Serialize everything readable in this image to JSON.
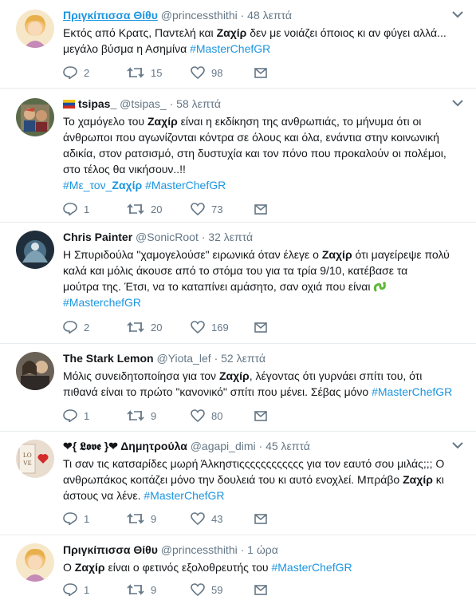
{
  "tweets": [
    {
      "name": "Πριγκίπισσα Θίθυ",
      "handle": "@princessthithi",
      "time": "48 λεπτά",
      "lines": [
        [
          {
            "t": "Εκτός από Κρατς, Παντελή και "
          },
          {
            "t": "Ζαχίρ",
            "b": true
          },
          {
            "t": " δεν με νοιάζει όποιος κι αν φύγει αλλά..."
          }
        ],
        [
          {
            "t": "μεγάλο βύσμα η Ασημίνα "
          },
          {
            "t": "#MasterChefGR",
            "h": true
          }
        ]
      ],
      "replies": "2",
      "retweets": "15",
      "likes": "98"
    },
    {
      "name": "tsipas_",
      "handle": "@tsipas_",
      "time": "58 λεπτά",
      "lines": [
        [
          {
            "t": "Το χαμόγελο του "
          },
          {
            "t": "Ζαχίρ",
            "b": true
          },
          {
            "t": " είναι η εκδίκηση της ανθρωπιάς, το μήνυμα ότι οι"
          }
        ],
        [
          {
            "t": "άνθρωποι που αγωνίζονται κόντρα σε όλους και όλα, ενάντια στην κοινωνική"
          }
        ],
        [
          {
            "t": "αδικία, στον ρατσισμό, στη δυστυχία και τον πόνο που προκαλούν οι πολέμοι,"
          }
        ],
        [
          {
            "t": "στο τέλος θα νικήσουν..!!"
          }
        ],
        [
          {
            "t": "#Με_τον_",
            "h": true
          },
          {
            "t": "Ζαχίρ",
            "h": true,
            "b": true
          },
          {
            "t": " "
          },
          {
            "t": "#MasterChefGR",
            "h": true
          }
        ]
      ],
      "replies": "1",
      "retweets": "20",
      "likes": "73"
    },
    {
      "name": "Chris Painter",
      "handle": "@SonicRoot",
      "time": "32 λεπτά",
      "lines": [
        [
          {
            "t": "Η Σπυριδούλα \"χαμογελούσε\" ειρωνικά όταν έλεγε ο "
          },
          {
            "t": "Ζαχίρ",
            "b": true
          },
          {
            "t": " ότι μαγείρεψε πολύ"
          }
        ],
        [
          {
            "t": "καλά και μόλις άκουσε από το στόμα του για τα τρία 9/10, κατέβασε τα"
          }
        ],
        [
          {
            "t": "μούτρα της. Έτσι, να το καταπίνει αμάσητο, σαν οχιά που είναι "
          },
          {
            "e": "snake"
          }
        ],
        [
          {
            "t": "#MasterchefGR",
            "h": true
          }
        ]
      ],
      "replies": "2",
      "retweets": "20",
      "likes": "169"
    },
    {
      "name": "The Stark Lemon",
      "handle": "@Yiota_lef",
      "time": "52 λεπτά",
      "lines": [
        [
          {
            "t": "Μόλις συνειδητοποίησα για τον "
          },
          {
            "t": "Ζαχίρ",
            "b": true
          },
          {
            "t": ", λέγοντας ότι γυρνάει σπίτι του, ότι"
          }
        ],
        [
          {
            "t": "πιθανά είναι το πρώτο \"κανονικό\" σπίτι που μένει. Σέβας μόνο "
          },
          {
            "t": "#MasterChefGR",
            "h": true
          }
        ]
      ],
      "replies": "1",
      "retweets": "9",
      "likes": "80"
    },
    {
      "name": "❤{ 𝕷𝖔𝖛𝖊 }❤ Δημητρούλα",
      "handle": "@agapi_dimi",
      "time": "45 λεπτά",
      "lines": [
        [
          {
            "t": "Τι σαν τις κατσαρίδες μωρή Άλκηστιςςςςςςςςςςςς για τον εαυτό σου μιλάς;;; Ο"
          }
        ],
        [
          {
            "t": "ανθρωπάκος κοιτάζει μόνο την δουλειά του κι αυτό ενοχλεί. Μπράβο "
          },
          {
            "t": "Ζαχίρ",
            "b": true
          },
          {
            "t": " κι"
          }
        ],
        [
          {
            "t": "άστους να λένε. "
          },
          {
            "t": "#MasterChefGR",
            "h": true
          }
        ]
      ],
      "replies": "1",
      "retweets": "9",
      "likes": "43"
    },
    {
      "name": "Πριγκίπισσα Θίθυ",
      "handle": "@princessthithi",
      "time": "1 ώρα",
      "lines": [
        [
          {
            "t": "Ο "
          },
          {
            "t": "Ζαχίρ",
            "b": true
          },
          {
            "t": " είναι ο φετινός εξολοθρευτής του "
          },
          {
            "t": "#MasterChefGR",
            "h": true
          }
        ]
      ],
      "replies": "1",
      "retweets": "9",
      "likes": "59"
    }
  ],
  "icons": {
    "reply": "reply-icon",
    "retweet": "retweet-icon",
    "like": "heart-icon",
    "dm": "envelope-icon",
    "more": "chevron-down-icon",
    "flag": "venezuela-flag-icon",
    "emoji": "snake-emoji-icon"
  },
  "colors": {
    "hashtag": "#1b95e0",
    "meta": "#657786",
    "text": "#14171a",
    "divider": "#e6ecf0",
    "heart": "#e0245e"
  }
}
